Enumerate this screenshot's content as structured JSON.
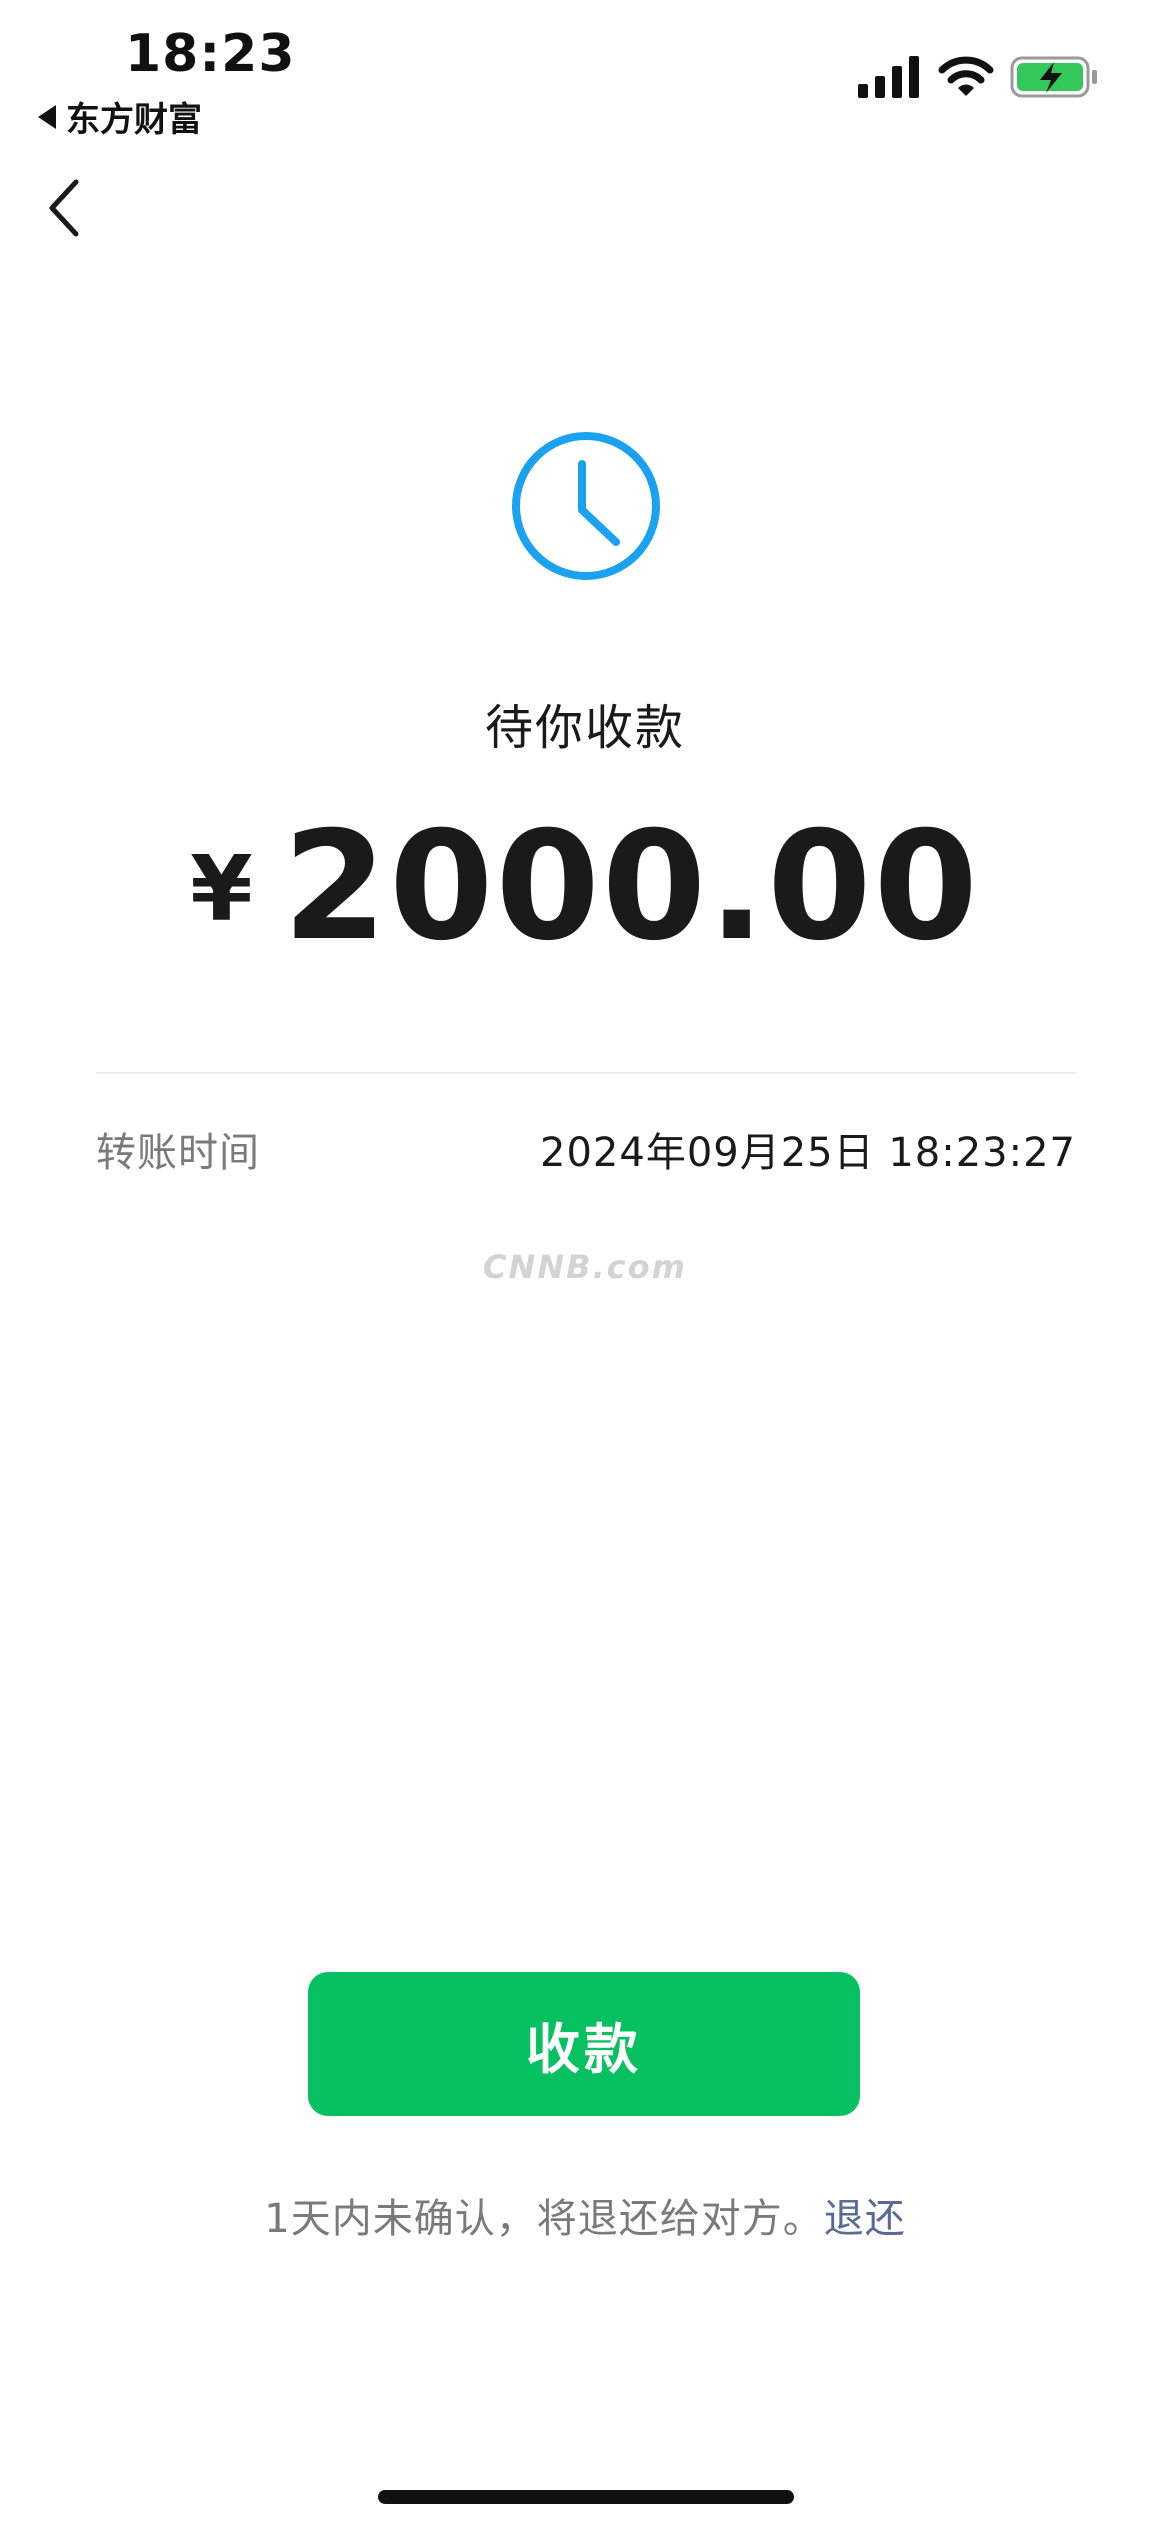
{
  "status_bar": {
    "time": "18:23",
    "back_app_label": "东方财富",
    "accent_battery": "#34c759"
  },
  "nav": {
    "back_icon": "chevron-left-icon"
  },
  "transfer": {
    "status_icon": "clock-icon",
    "status_color": "#1aa2f0",
    "status_text": "待你收款",
    "currency": "¥",
    "amount": "2000.00",
    "time_label": "转账时间",
    "time_value": "2024年09月25日 18:23:27"
  },
  "watermark": "CNNB.com",
  "actions": {
    "receive_label": "收款",
    "receive_color": "#07c160",
    "notice_text": "1天内未确认，将退还给对方。",
    "return_link": "退还",
    "return_link_color": "#576b95"
  }
}
